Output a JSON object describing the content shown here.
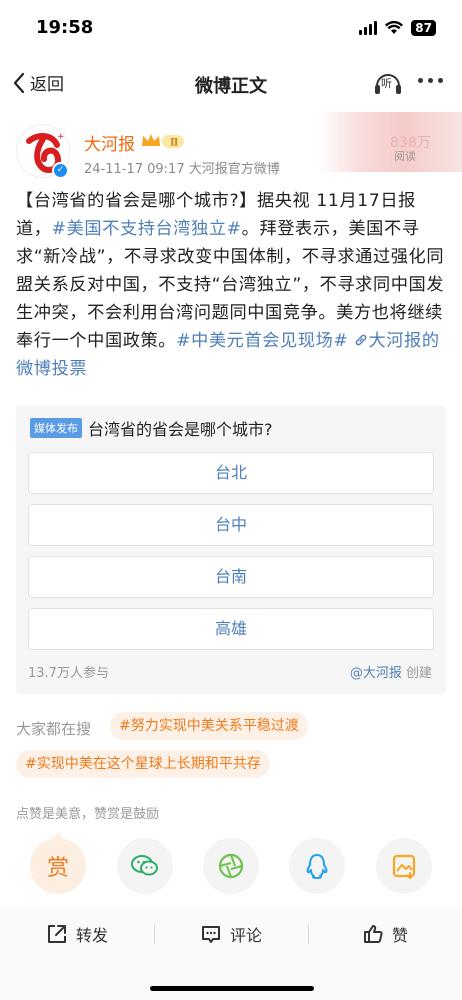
{
  "status": {
    "time": "19:58",
    "battery": "87"
  },
  "nav": {
    "back_label": "返回",
    "title": "微博正文",
    "listen_label": "听"
  },
  "post": {
    "author": "大河报",
    "avatar_badge": "+1",
    "member_level": "Ⅱ",
    "meta": "24-11-17 09:17  大河报官方微博",
    "read_count": "838万",
    "read_label": "阅读",
    "text_part1": "【台湾省的省会是哪个城市?】据央视 11月17日报道，",
    "tag1": "#美国不支持台湾独立#",
    "text_part2": "。拜登表示，美国不寻求“新冷战”，不寻求改变中国体制，不寻求通过强化同盟关系反对中国，不支持“台湾独立”，不寻求同中国发生冲突，不会利用台湾问题同中国竞争。美方也将继续奉行一个中国政策。",
    "tag2": "#中美元首会见现场#",
    "link_text": "大河报的微博投票"
  },
  "poll": {
    "badge": "媒体发布",
    "question": "台湾省的省会是哪个城市?",
    "options": [
      "台北",
      "台中",
      "台南",
      "高雄"
    ],
    "participants": "13.7万人参与",
    "creator": "@大河报",
    "creator_suffix": "创建"
  },
  "search": {
    "label": "大家都在搜",
    "tags": [
      "#努力实现中美关系平稳过渡",
      "#实现中美在这个星球上长期和平共存"
    ]
  },
  "reward": {
    "hint": "点赞是美意，赞赏是鼓励",
    "reward_label": "赏"
  },
  "bottom_bar": {
    "repost": "转发",
    "comment": "评论",
    "like": "赞"
  },
  "colors": {
    "accent_orange": "#f26a13",
    "link_blue": "#4f7fb8",
    "wechat_green": "#2aae67",
    "moments_green": "#6cc24a",
    "qq_blue": "#1ea0f0",
    "save_orange": "#f5a623"
  }
}
